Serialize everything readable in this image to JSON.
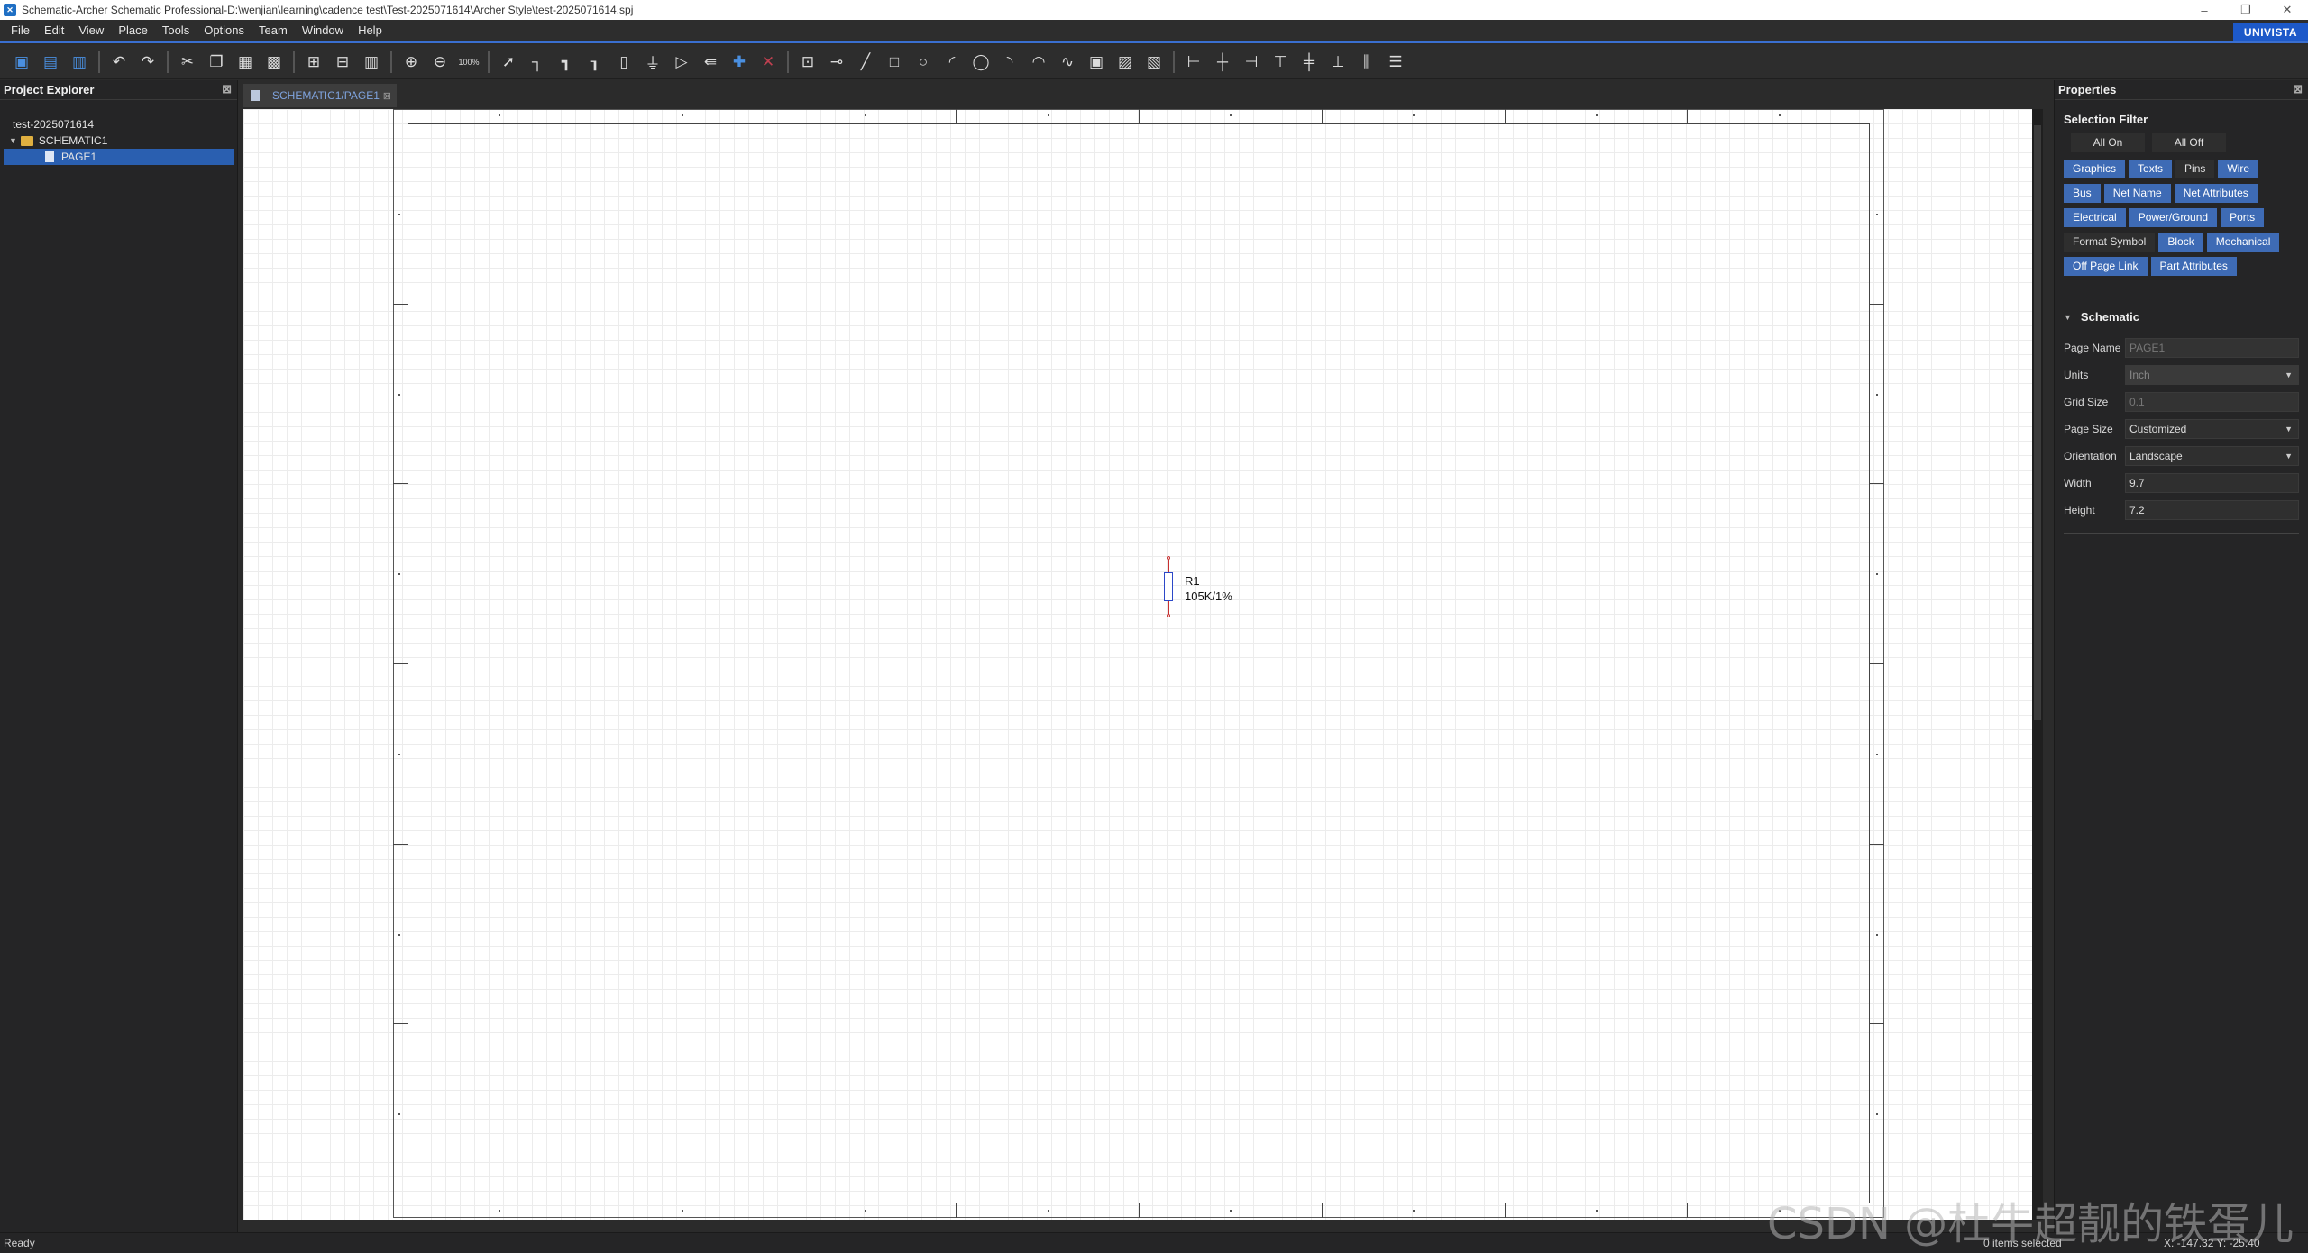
{
  "window": {
    "title": "Schematic-Archer Schematic Professional-D:\\wenjian\\learning\\cadence test\\Test-2025071614\\Archer Style\\test-2025071614.spj",
    "app_icon": "app-logo-icon"
  },
  "menu": {
    "items": [
      "File",
      "Edit",
      "View",
      "Place",
      "Tools",
      "Options",
      "Team",
      "Window",
      "Help"
    ],
    "brand": "UNIVISTA"
  },
  "toolbar": {
    "zoom_label": "100%"
  },
  "project_explorer": {
    "title": "Project Explorer",
    "root": "test-2025071614",
    "folder": "SCHEMATIC1",
    "page": "PAGE1"
  },
  "document": {
    "tab_label": "SCHEMATIC1/PAGE1",
    "component": {
      "ref": "R1",
      "value": "105K/1%"
    }
  },
  "properties": {
    "title": "Properties",
    "selection_filter": {
      "title": "Selection Filter",
      "all_on": "All On",
      "all_off": "All Off",
      "rows": [
        [
          {
            "label": "Graphics",
            "on": true
          },
          {
            "label": "Texts",
            "on": true
          },
          {
            "label": "Pins",
            "on": false
          },
          {
            "label": "Wire",
            "on": true
          }
        ],
        [
          {
            "label": "Bus",
            "on": true
          },
          {
            "label": "Net Name",
            "on": true
          },
          {
            "label": "Net Attributes",
            "on": true
          }
        ],
        [
          {
            "label": "Electrical",
            "on": true
          },
          {
            "label": "Power/Ground",
            "on": true
          },
          {
            "label": "Ports",
            "on": true
          }
        ],
        [
          {
            "label": "Format Symbol",
            "on": false
          },
          {
            "label": "Block",
            "on": true
          },
          {
            "label": "Mechanical",
            "on": true
          }
        ],
        [
          {
            "label": "Off Page Link",
            "on": true
          },
          {
            "label": "Part Attributes",
            "on": true
          }
        ]
      ]
    },
    "schematic": {
      "title": "Schematic",
      "page_name_label": "Page Name",
      "page_name": "PAGE1",
      "units_label": "Units",
      "units": "Inch",
      "grid_size_label": "Grid Size",
      "grid_size": "0.1",
      "page_size_label": "Page Size",
      "page_size": "Customized",
      "orientation_label": "Orientation",
      "orientation": "Landscape",
      "width_label": "Width",
      "width": "9.7",
      "height_label": "Height",
      "height": "7.2"
    }
  },
  "status": {
    "left": "Ready",
    "selection": "0  items  selected",
    "coords": "X: -147.32  Y: -25.40"
  },
  "watermark": "CSDN @杜牛超靓的铁蛋儿"
}
